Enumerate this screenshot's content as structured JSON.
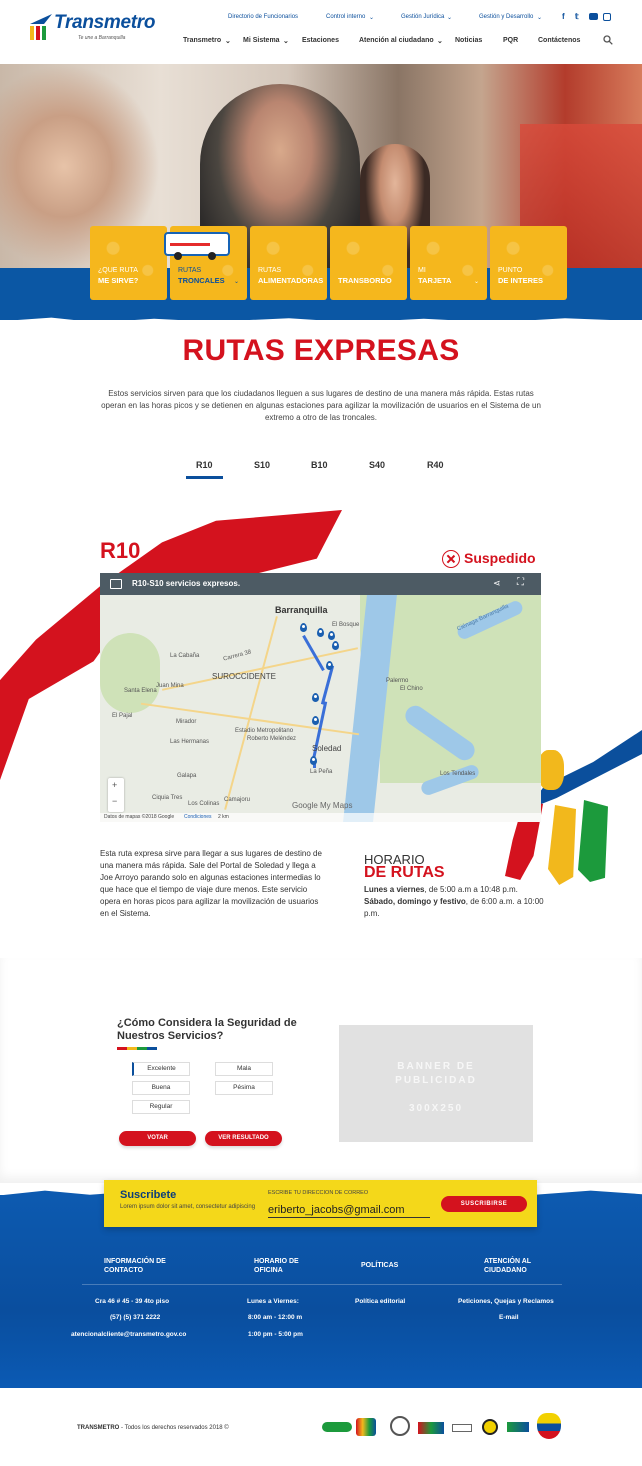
{
  "header": {
    "logo_text": "Transmetro",
    "logo_tagline": "Te une a Barranquilla",
    "top_links": [
      "Directorio de Funcionarios",
      "Control interno",
      "Gestión Jurídica",
      "Gestión y Desarrollo"
    ],
    "main_nav": [
      "Transmetro",
      "Mi Sistema",
      "Estaciones",
      "Atención al ciudadano",
      "Noticias",
      "PQR",
      "Contáctenos"
    ]
  },
  "tiles": [
    {
      "line1": "¿Que ruta",
      "line2": "me sirve?"
    },
    {
      "line1": "Rutas",
      "line2": "Troncales"
    },
    {
      "line1": "Rutas",
      "line2": "Alimentadoras"
    },
    {
      "line1": "",
      "line2": "Transbordo"
    },
    {
      "line1": "Mi",
      "line2": "Tarjeta"
    },
    {
      "line1": "Punto",
      "line2": "de interes"
    }
  ],
  "section": {
    "title": "RUTAS EXPRESAS",
    "intro": "Estos servicios sirven para que los ciudadanos lleguen a sus lugares de destino de una manera más rápida. Estas rutas operan en las horas picos y se detienen en algunas estaciones para agilizar la movilización de usuarios en el Sistema de un extremo a otro de las troncales."
  },
  "tabs": [
    "R10",
    "S10",
    "B10",
    "S40",
    "R40"
  ],
  "route": {
    "code": "R10",
    "status": "Suspedido",
    "map_title": "R10-S10 servicios expresos.",
    "map_labels": {
      "barranquilla": "Barranquilla",
      "suroccidente": "SUROCCIDENTE",
      "soledad": "Soledad",
      "estadio": "Estadio Metropolitano",
      "estadio2": "Roberto Meléndez",
      "la_cabana": "La Cabaña",
      "juan_mina": "Juan Mina",
      "santa_elena": "Santa Elena",
      "el_pajal": "El Pajal",
      "mirador": "Mirador",
      "las_hermanas": "Las Hermanas",
      "galapa": "Galapa",
      "cuigia": "Ciquia Tres",
      "los_colinas": "Los Colinas",
      "camajoru": "Camajoru",
      "palermo": "Palermo",
      "el_chino": "El Chino",
      "los_tendales": "Los Tendales",
      "el_bosque": "El Bosque",
      "la_peña": "La Peña",
      "carrera": "Carrera 38",
      "cienaga": "Ciénaga Barranquilla",
      "attribution": "Datos de mapas ©2018 Google",
      "conditions": "Condiciones",
      "scale": "2 km",
      "google": "Google My Maps"
    },
    "description": "Esta ruta expresa sirve para llegar a sus lugares de destino de una manera más rápida. Sale del Portal de Soledad y llega a Joe Arroyo parando solo en algunas estaciones intermedias lo que hace que el tiempo de viaje dure menos. Este servicio opera en horas picos para agilizar la movilización de usuarios en el Sistema.",
    "schedule_title1": "HORARIO",
    "schedule_title2": "DE RUTAS",
    "schedule_weekday_label": "Lunes a viernes",
    "schedule_weekday": ", de 5:00 a.m a 10:48 p.m.",
    "schedule_weekend_label": "Sábado, domingo y festivo",
    "schedule_weekend": ", de 6:00 a.m. a 10:00 p.m."
  },
  "poll": {
    "title": "¿Cómo Considera la Seguridad de Nuestros Servicios?",
    "options": [
      "Excelente",
      "Mala",
      "Buena",
      "Pésima",
      "Regular"
    ],
    "vote_label": "VOTAR",
    "results_label": "VER RESULTADO"
  },
  "ad": {
    "line1": "BANNER DE",
    "line2": "PUBLICIDAD",
    "size": "300X250"
  },
  "subscribe": {
    "title": "Suscribete",
    "desc": "Lorem ipsum dolor sit amet, consectetur adipiscing",
    "field_label": "ESCRIBE TU DIRECCION DE CORREO",
    "email": "eriberto_jacobs@gmail.com",
    "button": "SUSCRIBIRSE"
  },
  "footer": {
    "col1_h1": "INFORMACIÓN DE",
    "col1_h2": "CONTACTO",
    "col2_h1": "HORARIO DE",
    "col2_h2": "OFICINA",
    "col3_h": "POLÍTICAS",
    "col4_h1": "ATENCIÓN AL",
    "col4_h2": "CIUDADANO",
    "address": "Cra 46 # 45 - 39 4to piso",
    "phone": "(57) (5) 371 2222",
    "email": "atencionalcliente@transmetro.gov.co",
    "hours_label": "Lunes a Viernes:",
    "hours1": "8:00 am - 12:00 m",
    "hours2": "1:00 pm - 5:00 pm",
    "policy": "Política editorial",
    "pqr": "Peticiones, Quejas y Reclamos",
    "email_link": "E-mail"
  },
  "bottom": {
    "brand": "TRANSMETRO",
    "rights": "- Todos los derechos reservados 2018 ©"
  },
  "colors": {
    "brand_blue": "#0b4f9c",
    "brand_red": "#d4121e",
    "tile_yellow": "#f5b71d"
  }
}
